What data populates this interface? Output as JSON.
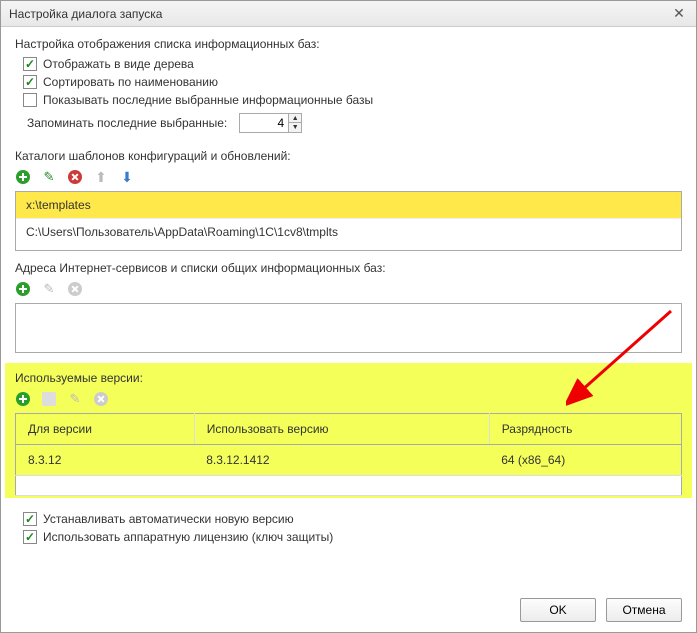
{
  "window": {
    "title": "Настройка диалога запуска"
  },
  "display": {
    "section_label": "Настройка отображения списка информационных баз:",
    "tree_checkbox": "Отображать в виде дерева",
    "sort_checkbox": "Сортировать по наименованию",
    "recent_checkbox": "Показывать последние выбранные информационные базы",
    "remember_label": "Запоминать последние выбранные:",
    "remember_value": "4"
  },
  "templates": {
    "section_label": "Каталоги шаблонов конфигураций и обновлений:",
    "rows": {
      "0": "x:\\templates",
      "1": "C:\\Users\\Пользователь\\AppData\\Roaming\\1C\\1cv8\\tmplts"
    }
  },
  "services": {
    "section_label": "Адреса Интернет-сервисов и списки общих информационных баз:"
  },
  "versions": {
    "section_label": "Используемые версии:",
    "col_for": "Для версии",
    "col_use": "Использовать версию",
    "col_arch": "Разрядность",
    "rows": {
      "0": {
        "for": "8.3.12",
        "use": "8.3.12.1412",
        "arch": "64 (x86_64)"
      }
    }
  },
  "auto": {
    "auto_update": "Устанавливать автоматически новую версию",
    "hw_license": "Использовать аппаратную лицензию (ключ защиты)"
  },
  "buttons": {
    "ok": "OK",
    "cancel": "Отмена"
  }
}
